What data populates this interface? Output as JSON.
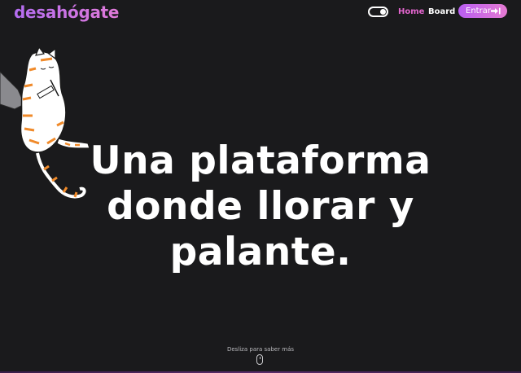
{
  "nav": {
    "logo": "desahógate",
    "theme_toggle_icon": "theme-toggle-icon",
    "home_label": "Home",
    "board_label": "Board",
    "enter_label": "Entrar",
    "enter_icon": "sign-in-icon"
  },
  "hero": {
    "illustration": "cat-illustration",
    "headline_line1": "Una plataforma",
    "headline_line2": "donde llorar y",
    "headline_line3": "palante."
  },
  "footer": {
    "scroll_hint": "Desliza para saber más",
    "scroll_icon": "mouse-scroll-icon"
  },
  "colors": {
    "background": "#1a1a1c",
    "accent": "#e466cf",
    "gradient_start": "#b95ef2",
    "gradient_end": "#e57ad2"
  }
}
